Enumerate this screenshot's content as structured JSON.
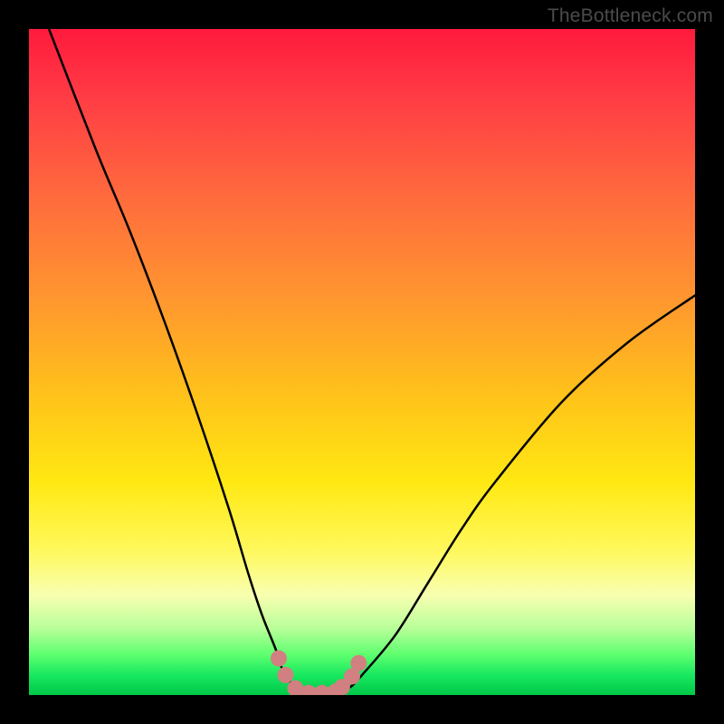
{
  "watermark": "TheBottleneck.com",
  "chart_data": {
    "type": "line",
    "title": "",
    "xlabel": "",
    "ylabel": "",
    "xlim": [
      0,
      100
    ],
    "ylim": [
      0,
      100
    ],
    "series": [
      {
        "name": "bottleneck-curve",
        "x": [
          3,
          10,
          15,
          20,
          25,
          30,
          33,
          35,
          37,
          38,
          40,
          42,
          44,
          46,
          48,
          50,
          55,
          60,
          65,
          70,
          80,
          90,
          100
        ],
        "values": [
          100,
          82,
          70,
          57,
          43,
          28,
          18,
          12,
          7,
          4,
          1,
          0,
          0,
          0,
          1,
          3,
          9,
          17,
          25,
          32,
          44,
          53,
          60
        ]
      }
    ],
    "trough_markers": {
      "name": "curve-floor-dots",
      "x": [
        37.5,
        38.5,
        40,
        42,
        44,
        46,
        47,
        48.5,
        49.5
      ],
      "values": [
        5.5,
        3,
        1,
        0.3,
        0.3,
        0.5,
        1.2,
        2.8,
        4.8
      ]
    },
    "background_gradient": {
      "orientation": "vertical",
      "stops": [
        {
          "pos": 0.0,
          "color": "#ff1a3c"
        },
        {
          "pos": 0.25,
          "color": "#ff6a3d"
        },
        {
          "pos": 0.55,
          "color": "#ffc21a"
        },
        {
          "pos": 0.78,
          "color": "#fff85a"
        },
        {
          "pos": 0.9,
          "color": "#b8ff9a"
        },
        {
          "pos": 1.0,
          "color": "#00c848"
        }
      ]
    }
  }
}
